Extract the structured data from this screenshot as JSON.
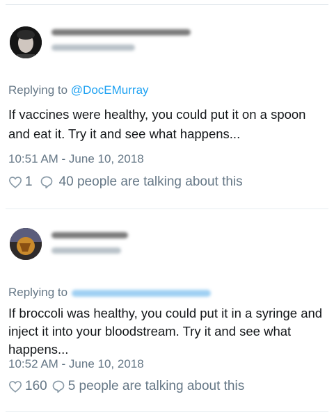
{
  "tweets": [
    {
      "replying_prefix": "Replying to",
      "replying_handle": "@DocEMurray",
      "body": "If vaccines were healthy, you could put it on a spoon and eat it. Try it and see what happens...",
      "timestamp": "10:51 AM - June 10, 2018",
      "like_count": "1",
      "talking": "40 people are talking about this"
    },
    {
      "replying_prefix": "Replying to",
      "body": "If broccoli was healthy, you could put it in a syringe and inject it into your bloodstream. Try it and see what happens...",
      "timestamp": "10:52 AM - June 10, 2018",
      "like_count": "160",
      "talking": "5 people are talking about this"
    }
  ],
  "colors": {
    "link": "#1da1f2",
    "muted": "#657786",
    "text": "#14171a",
    "divider": "#e6ecf0"
  },
  "icons": [
    "heart-icon",
    "comment-bubble-icon"
  ]
}
